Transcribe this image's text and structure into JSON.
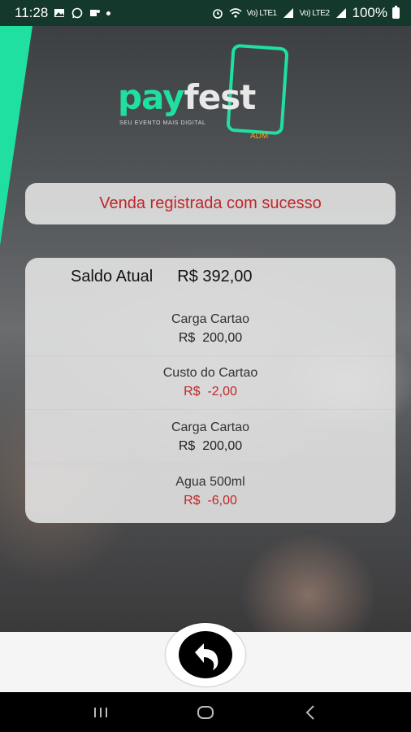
{
  "status_bar": {
    "time": "11:28",
    "signal_label_1": "Vo) LTE1",
    "signal_label_2": "Vo) LTE2",
    "battery": "100%"
  },
  "logo": {
    "word_pay": "pay",
    "word_fest": "fest",
    "tagline": "SEU EVENTO MAIS DIGITAL",
    "badge": "ADM"
  },
  "message": "Venda registrada com sucesso",
  "balance": {
    "label": "Saldo Atual",
    "value": "R$ 392,00"
  },
  "transactions": [
    {
      "description": "Carga Cartao",
      "amount": "R$  200,00",
      "negative": false
    },
    {
      "description": "Custo do Cartao",
      "amount": "R$  -2,00",
      "negative": true
    },
    {
      "description": "Carga Cartao",
      "amount": "R$  200,00",
      "negative": false
    },
    {
      "description": "Agua 500ml",
      "amount": "R$  -6,00",
      "negative": true
    }
  ],
  "colors": {
    "accent": "#1fe0a0",
    "error_text": "#c0262a",
    "status_bar": "#14382c"
  },
  "icons": {
    "back_button": "back-arrow-icon",
    "nav_recents": "recents-icon",
    "nav_home": "home-icon",
    "nav_back": "nav-back-icon"
  }
}
